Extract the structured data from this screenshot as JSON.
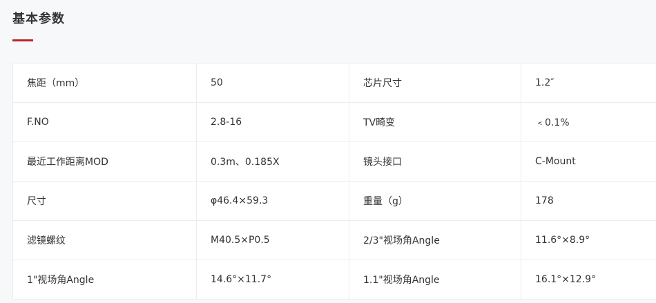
{
  "section": {
    "title": "基本参数"
  },
  "accent_color": "#b5262b",
  "specs": {
    "rows": [
      {
        "label1": "焦距（mm）",
        "value1": "50",
        "label2": "芯片尺寸",
        "value2": "1.2″"
      },
      {
        "label1": "F.NO",
        "value1": "2.8-16",
        "label2": "TV畸变",
        "value2": "﹤0.1%"
      },
      {
        "label1": "最近工作距离MOD",
        "value1": "0.3m、0.185X",
        "label2": "镜头接口",
        "value2": "C-Mount"
      },
      {
        "label1": "尺寸",
        "value1": "φ46.4×59.3",
        "label2": "重量（g）",
        "value2": "178"
      },
      {
        "label1": "滤镜螺纹",
        "value1": "M40.5×P0.5",
        "label2": "2/3\"视场角Angle",
        "value2": "11.6°×8.9°"
      },
      {
        "label1": "1\"视场角Angle",
        "value1": "14.6°×11.7°",
        "label2": "1.1\"视场角Angle",
        "value2": "16.1°×12.9°"
      }
    ]
  }
}
